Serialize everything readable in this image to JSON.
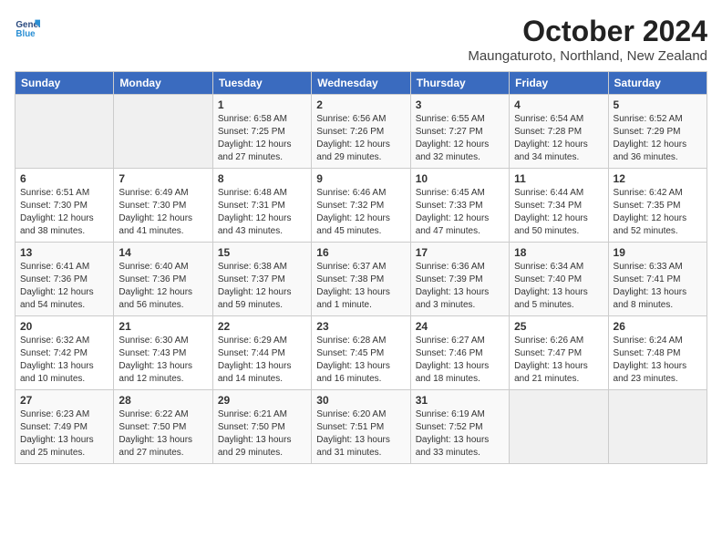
{
  "header": {
    "logo_line1": "General",
    "logo_line2": "Blue",
    "month": "October 2024",
    "location": "Maungaturoto, Northland, New Zealand"
  },
  "weekdays": [
    "Sunday",
    "Monday",
    "Tuesday",
    "Wednesday",
    "Thursday",
    "Friday",
    "Saturday"
  ],
  "weeks": [
    [
      {
        "day": "",
        "info": ""
      },
      {
        "day": "",
        "info": ""
      },
      {
        "day": "1",
        "info": "Sunrise: 6:58 AM\nSunset: 7:25 PM\nDaylight: 12 hours\nand 27 minutes."
      },
      {
        "day": "2",
        "info": "Sunrise: 6:56 AM\nSunset: 7:26 PM\nDaylight: 12 hours\nand 29 minutes."
      },
      {
        "day": "3",
        "info": "Sunrise: 6:55 AM\nSunset: 7:27 PM\nDaylight: 12 hours\nand 32 minutes."
      },
      {
        "day": "4",
        "info": "Sunrise: 6:54 AM\nSunset: 7:28 PM\nDaylight: 12 hours\nand 34 minutes."
      },
      {
        "day": "5",
        "info": "Sunrise: 6:52 AM\nSunset: 7:29 PM\nDaylight: 12 hours\nand 36 minutes."
      }
    ],
    [
      {
        "day": "6",
        "info": "Sunrise: 6:51 AM\nSunset: 7:30 PM\nDaylight: 12 hours\nand 38 minutes."
      },
      {
        "day": "7",
        "info": "Sunrise: 6:49 AM\nSunset: 7:30 PM\nDaylight: 12 hours\nand 41 minutes."
      },
      {
        "day": "8",
        "info": "Sunrise: 6:48 AM\nSunset: 7:31 PM\nDaylight: 12 hours\nand 43 minutes."
      },
      {
        "day": "9",
        "info": "Sunrise: 6:46 AM\nSunset: 7:32 PM\nDaylight: 12 hours\nand 45 minutes."
      },
      {
        "day": "10",
        "info": "Sunrise: 6:45 AM\nSunset: 7:33 PM\nDaylight: 12 hours\nand 47 minutes."
      },
      {
        "day": "11",
        "info": "Sunrise: 6:44 AM\nSunset: 7:34 PM\nDaylight: 12 hours\nand 50 minutes."
      },
      {
        "day": "12",
        "info": "Sunrise: 6:42 AM\nSunset: 7:35 PM\nDaylight: 12 hours\nand 52 minutes."
      }
    ],
    [
      {
        "day": "13",
        "info": "Sunrise: 6:41 AM\nSunset: 7:36 PM\nDaylight: 12 hours\nand 54 minutes."
      },
      {
        "day": "14",
        "info": "Sunrise: 6:40 AM\nSunset: 7:36 PM\nDaylight: 12 hours\nand 56 minutes."
      },
      {
        "day": "15",
        "info": "Sunrise: 6:38 AM\nSunset: 7:37 PM\nDaylight: 12 hours\nand 59 minutes."
      },
      {
        "day": "16",
        "info": "Sunrise: 6:37 AM\nSunset: 7:38 PM\nDaylight: 13 hours\nand 1 minute."
      },
      {
        "day": "17",
        "info": "Sunrise: 6:36 AM\nSunset: 7:39 PM\nDaylight: 13 hours\nand 3 minutes."
      },
      {
        "day": "18",
        "info": "Sunrise: 6:34 AM\nSunset: 7:40 PM\nDaylight: 13 hours\nand 5 minutes."
      },
      {
        "day": "19",
        "info": "Sunrise: 6:33 AM\nSunset: 7:41 PM\nDaylight: 13 hours\nand 8 minutes."
      }
    ],
    [
      {
        "day": "20",
        "info": "Sunrise: 6:32 AM\nSunset: 7:42 PM\nDaylight: 13 hours\nand 10 minutes."
      },
      {
        "day": "21",
        "info": "Sunrise: 6:30 AM\nSunset: 7:43 PM\nDaylight: 13 hours\nand 12 minutes."
      },
      {
        "day": "22",
        "info": "Sunrise: 6:29 AM\nSunset: 7:44 PM\nDaylight: 13 hours\nand 14 minutes."
      },
      {
        "day": "23",
        "info": "Sunrise: 6:28 AM\nSunset: 7:45 PM\nDaylight: 13 hours\nand 16 minutes."
      },
      {
        "day": "24",
        "info": "Sunrise: 6:27 AM\nSunset: 7:46 PM\nDaylight: 13 hours\nand 18 minutes."
      },
      {
        "day": "25",
        "info": "Sunrise: 6:26 AM\nSunset: 7:47 PM\nDaylight: 13 hours\nand 21 minutes."
      },
      {
        "day": "26",
        "info": "Sunrise: 6:24 AM\nSunset: 7:48 PM\nDaylight: 13 hours\nand 23 minutes."
      }
    ],
    [
      {
        "day": "27",
        "info": "Sunrise: 6:23 AM\nSunset: 7:49 PM\nDaylight: 13 hours\nand 25 minutes."
      },
      {
        "day": "28",
        "info": "Sunrise: 6:22 AM\nSunset: 7:50 PM\nDaylight: 13 hours\nand 27 minutes."
      },
      {
        "day": "29",
        "info": "Sunrise: 6:21 AM\nSunset: 7:50 PM\nDaylight: 13 hours\nand 29 minutes."
      },
      {
        "day": "30",
        "info": "Sunrise: 6:20 AM\nSunset: 7:51 PM\nDaylight: 13 hours\nand 31 minutes."
      },
      {
        "day": "31",
        "info": "Sunrise: 6:19 AM\nSunset: 7:52 PM\nDaylight: 13 hours\nand 33 minutes."
      },
      {
        "day": "",
        "info": ""
      },
      {
        "day": "",
        "info": ""
      }
    ]
  ]
}
